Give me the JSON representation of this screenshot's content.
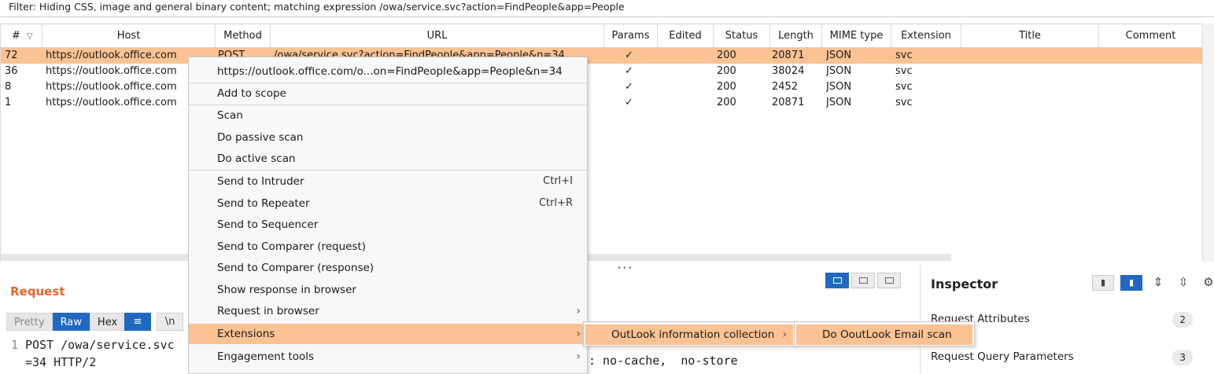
{
  "filter_text": "Filter: Hiding CSS, image and general binary content;  matching expression /owa/service.svc?action=FindPeople&app=People",
  "columns": [
    "#",
    "Host",
    "Method",
    "URL",
    "Params",
    "Edited",
    "Status",
    "Length",
    "MIME type",
    "Extension",
    "Title",
    "Comment"
  ],
  "sort_icon": "chevron-down-icon",
  "rows": [
    {
      "num": "72",
      "host": "https://outlook.office.com",
      "method": "POST",
      "url": "/owa/service.svc?action=FindPeople&app=People&n=34",
      "params": "✓",
      "status": "200",
      "length": "20871",
      "mime": "JSON",
      "ext": "svc"
    },
    {
      "num": "36",
      "host": "https://outlook.office.com",
      "params": "✓",
      "status": "200",
      "length": "38024",
      "mime": "JSON",
      "ext": "svc"
    },
    {
      "num": "8",
      "host": "https://outlook.office.com",
      "params": "✓",
      "status": "200",
      "length": "2452",
      "mime": "JSON",
      "ext": "svc"
    },
    {
      "num": "1",
      "host": "https://outlook.office.com",
      "params": "✓",
      "status": "200",
      "length": "20871",
      "mime": "JSON",
      "ext": "svc"
    }
  ],
  "selected_row_color": "#fbc293",
  "context_menu": {
    "header_url": "https://outlook.office.com/o...on=FindPeople&app=People&n=34",
    "add_to_scope": "Add to scope",
    "scan": "Scan",
    "passive_scan": "Do passive scan",
    "active_scan": "Do active scan",
    "send_intruder": "Send to Intruder",
    "send_intruder_shortcut": "Ctrl+I",
    "send_repeater": "Send to Repeater",
    "send_repeater_shortcut": "Ctrl+R",
    "send_sequencer": "Send to Sequencer",
    "send_comparer_req": "Send to Comparer (request)",
    "send_comparer_resp": "Send to Comparer (response)",
    "show_response": "Show response in browser",
    "request_in_browser": "Request in browser",
    "extensions": "Extensions",
    "engagement_tools": "Engagement tools"
  },
  "submenu": {
    "outlook_collection": "OutLook information collection",
    "do_scan": "Do OoutLook Email scan"
  },
  "request_pane": {
    "title": "Request",
    "tabs": [
      "Pretty",
      "Raw",
      "Hex"
    ],
    "active_tab": "Raw",
    "newline_btn": "\\n",
    "code_line_num": "1",
    "code_line1": "POST /owa/service.svc",
    "code_line2": "=34 HTTP/2"
  },
  "response_snippet": ": no-cache,  no-store",
  "inspector": {
    "title": "Inspector",
    "items": [
      {
        "label": "Request Attributes",
        "count": "2"
      },
      {
        "label": "Request Query Parameters",
        "count": "3"
      }
    ]
  },
  "accent_color": "#1f69c0",
  "title_color": "#e8632c"
}
